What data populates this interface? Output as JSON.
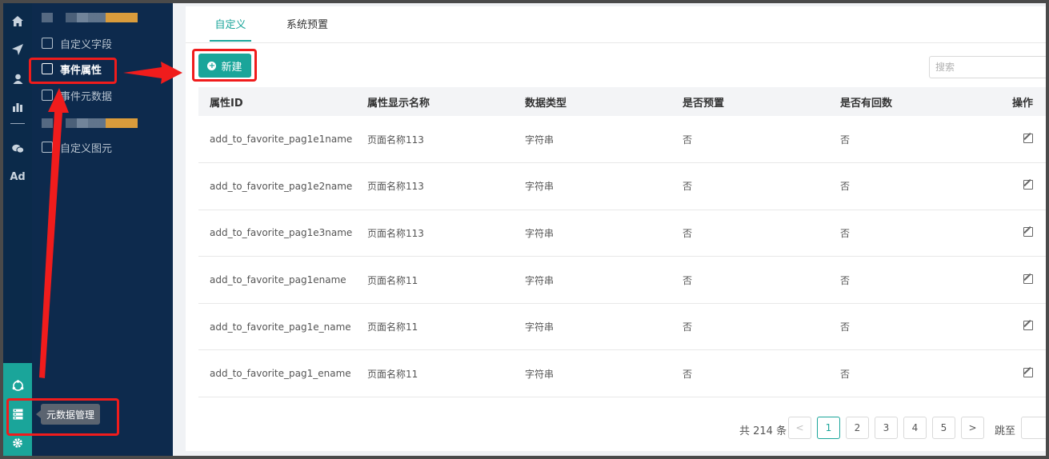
{
  "rail": {
    "icons": [
      "home-icon",
      "send-icon",
      "user-icon",
      "bar-chart-icon",
      "wechat-icon",
      "ad-icon",
      "hub-icon",
      "server-icon",
      "gear-icon"
    ],
    "ad_label": "Ad"
  },
  "menu": {
    "items": [
      {
        "label": "自定义字段",
        "icon": "form-icon"
      },
      {
        "label": "事件属性",
        "icon": "clipboard-icon",
        "active": true
      },
      {
        "label": "事件元数据",
        "icon": "list-icon"
      },
      {
        "label": "自定义图元",
        "icon": "cube-icon"
      }
    ],
    "tooltip": "元数据管理"
  },
  "tabs": [
    {
      "label": "自定义",
      "active": true
    },
    {
      "label": "系统预置",
      "active": false
    }
  ],
  "toolbar": {
    "new_label": "新建",
    "search_placeholder": "搜索"
  },
  "table": {
    "headers": [
      "属性ID",
      "属性显示名称",
      "数据类型",
      "是否预置",
      "是否有回数",
      "操作"
    ],
    "rows": [
      [
        "add_to_favorite_pag1e1name",
        "页面名称113",
        "字符串",
        "否",
        "否"
      ],
      [
        "add_to_favorite_pag1e2name",
        "页面名称113",
        "字符串",
        "否",
        "否"
      ],
      [
        "add_to_favorite_pag1e3name",
        "页面名称113",
        "字符串",
        "否",
        "否"
      ],
      [
        "add_to_favorite_pag1ename",
        "页面名称11",
        "字符串",
        "否",
        "否"
      ],
      [
        "add_to_favorite_pag1e_name",
        "页面名称11",
        "字符串",
        "否",
        "否"
      ],
      [
        "add_to_favorite_pag1_ename",
        "页面名称11",
        "字符串",
        "否",
        "否"
      ]
    ]
  },
  "pagination": {
    "total": "共 214 条",
    "prev": "<",
    "pages": [
      "1",
      "2",
      "3",
      "4",
      "5"
    ],
    "current": "1",
    "next": ">",
    "jump_label": "跳至"
  },
  "colors": {
    "accent": "#1aa59a",
    "sidebar": "#0d2a4d",
    "annotation": "#f01c1c"
  }
}
